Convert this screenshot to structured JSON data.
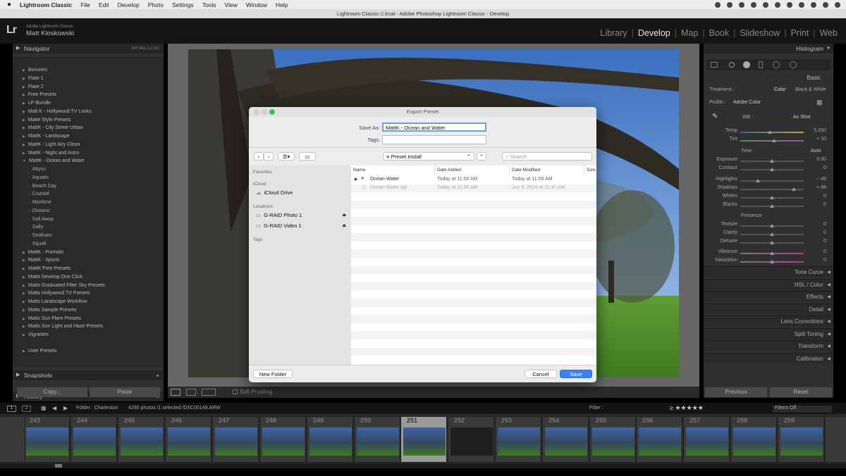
{
  "menubar": {
    "apple": "",
    "app_name": "Lightroom Classic",
    "items": [
      "File",
      "Edit",
      "Develop",
      "Photo",
      "Settings",
      "Tools",
      "View",
      "Window",
      "Help"
    ]
  },
  "window_title": "Lightroom Classic-2.lrcat - Adobe Photoshop Lightroom Classic - Develop",
  "identity": {
    "logo": "Lr",
    "line1": "Adobe Lightroom Classic",
    "line2": "Matt Kloskowski"
  },
  "modules": [
    "Library",
    "Develop",
    "Map",
    "Book",
    "Slideshow",
    "Print",
    "Web"
  ],
  "active_module": "Develop",
  "left": {
    "navigator": "Navigator",
    "nav_opts": "FIT  FILL  1:1  3:1",
    "presets": [
      "Bonuses",
      "Flare 1",
      "Flare 2",
      "Free Presets",
      "LP Bundle",
      "Matt K - Hollywood TV Looks",
      "Matte Style Presets",
      "MattK - City Street Urban",
      "MattK - Landscape",
      "MattK - Light Airy Clean",
      "MattK - Night and Astro",
      "MattK - Ocean and Water"
    ],
    "subpresets": [
      "Abyss",
      "Aquatic",
      "Beach Day",
      "Coastal",
      "Maritime",
      "Oceanic",
      "Sail Away",
      "Salty",
      "Seafoam",
      "Squall"
    ],
    "presets2": [
      "MattK - Portraits",
      "MattK - Sports",
      "MattK Free Presets",
      "Matts Develop One Click",
      "Matts Graduated Filter Sky Presets",
      "Matts Hollywood TV Presets",
      "Matts Landscape Workflow",
      "Matts Sample Presets",
      "Matts Sun Flare Presets",
      "Matts Sun Light and Haze Presets",
      "Vignettes"
    ],
    "user_presets": "User Presets",
    "snapshots": "Snapshots",
    "history": "History",
    "copy": "Copy...",
    "paste": "Paste"
  },
  "toolbar": {
    "soft_proofing": "Soft Proofing"
  },
  "right": {
    "histogram": "Histogram",
    "basic": "Basic",
    "treatment": "Treatment :",
    "color": "Color",
    "bw": "Black & White",
    "profile": "Profile :",
    "profile_val": "Adobe Color",
    "wb": "WB :",
    "wb_val": "As Shot",
    "tone": "Tone",
    "auto": "Auto",
    "presence": "Presence",
    "sliders": [
      {
        "label": "Temp",
        "value": "5,150",
        "pos": 0.47,
        "group": "wb"
      },
      {
        "label": "Tint",
        "value": "+ 10",
        "pos": 0.53,
        "group": "wb"
      },
      {
        "label": "Exposure",
        "value": "0.00",
        "pos": 0.5,
        "group": "tone"
      },
      {
        "label": "Contrast",
        "value": "0",
        "pos": 0.5,
        "group": "tone"
      },
      {
        "label": "Highlights",
        "value": "− 45",
        "pos": 0.28,
        "group": "tone"
      },
      {
        "label": "Shadows",
        "value": "+ 68",
        "pos": 0.84,
        "group": "tone"
      },
      {
        "label": "Whites",
        "value": "0",
        "pos": 0.5,
        "group": "tone"
      },
      {
        "label": "Blacks",
        "value": "0",
        "pos": 0.5,
        "group": "tone"
      },
      {
        "label": "Texture",
        "value": "0",
        "pos": 0.5,
        "group": "presence"
      },
      {
        "label": "Clarity",
        "value": "0",
        "pos": 0.5,
        "group": "presence"
      },
      {
        "label": "Dehaze",
        "value": "0",
        "pos": 0.5,
        "group": "presence"
      },
      {
        "label": "Vibrance",
        "value": "0",
        "pos": 0.5,
        "group": "presence"
      },
      {
        "label": "Saturation",
        "value": "0",
        "pos": 0.5,
        "group": "presence"
      }
    ],
    "sections": [
      "Tone Curve",
      "HSL / Color",
      "Effects",
      "Detail",
      "Lens Corrections",
      "Split Toning",
      "Transform",
      "Calibration"
    ],
    "previous": "Previous",
    "reset": "Reset"
  },
  "filmstrip": {
    "view1": "1",
    "view2": "2",
    "folder": "Folder : Charleston",
    "count": "4290 photos /1 selected /DSC00149.ARW",
    "filter": "Filter :",
    "filters_off": "Filters Off",
    "numbers": [
      "243",
      "244",
      "245",
      "246",
      "247",
      "248",
      "249",
      "250",
      "251",
      "252",
      "253",
      "254",
      "255",
      "256",
      "257",
      "258",
      "259"
    ],
    "selected_index": 8
  },
  "dialog": {
    "title": "Export Preset",
    "save_as_label": "Save As:",
    "save_as_value": "MattK - Ocean and Water",
    "tags_label": "Tags:",
    "location": "Preset Install",
    "search_placeholder": "Search",
    "sidebar": {
      "favorites": "Favorites",
      "icloud": "iCloud",
      "icloud_drive": "iCloud Drive",
      "locations": "Locations",
      "loc1": "G-RAID Photo 1",
      "loc2": "G-RAID Video 1",
      "tags": "Tags"
    },
    "columns": [
      "Name",
      "Date Added",
      "Date Modified",
      "Size"
    ],
    "rows": [
      {
        "name": "Ocean-Water",
        "added": "Today at 11:56 AM",
        "modified": "Today at 11:56 AM",
        "folder": true
      },
      {
        "name": "Ocean-Water.zip",
        "added": "Today at 11:56 AM",
        "modified": "Jun 6, 2019 at 11:37 AM",
        "folder": false
      }
    ],
    "new_folder": "New Folder",
    "cancel": "Cancel",
    "save": "Save"
  }
}
